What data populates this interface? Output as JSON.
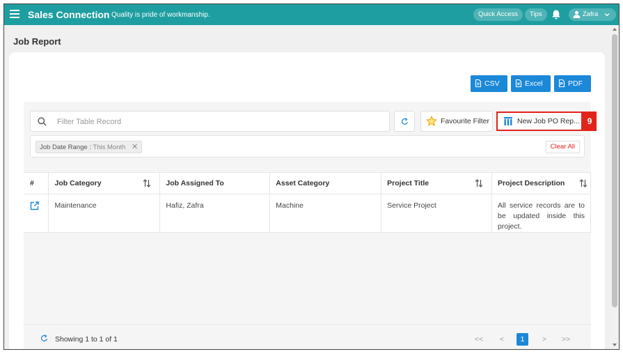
{
  "topbar": {
    "brand": "Sales Connection",
    "tagline": "Quality is pride of workmanship.",
    "quick_access": "Quick Access",
    "tips": "Tips",
    "user": "Zafra"
  },
  "page": {
    "title": "Job Report"
  },
  "export": {
    "csv": "CSV",
    "excel": "Excel",
    "pdf": "PDF"
  },
  "toolbar": {
    "search_placeholder": "Filter Table Record",
    "favourite": "Favourite Filter",
    "report": "New Job PO Rep...",
    "badge": "9"
  },
  "filter": {
    "chip_label": "Job Date Range :",
    "chip_value": "This Month",
    "clear_all": "Clear All"
  },
  "table": {
    "headers": [
      "#",
      "Job Category",
      "Job Assigned To",
      "Asset Category",
      "Project Title",
      "Project Description"
    ],
    "rows": [
      {
        "job_category": "Maintenance",
        "job_assigned_to": "Hafiz, Zafra",
        "asset_category": "Machine",
        "project_title": "Service Project",
        "project_description": "All service records are to be updated inside this project."
      }
    ]
  },
  "footer": {
    "showing": "Showing 1 to 1 of 1",
    "first": "<<",
    "prev": "<",
    "current_page": "1",
    "next": ">",
    "last": ">>"
  },
  "colors": {
    "topbar": "#1f9ea1",
    "primary": "#1b88d8",
    "highlight": "#e2231a"
  }
}
